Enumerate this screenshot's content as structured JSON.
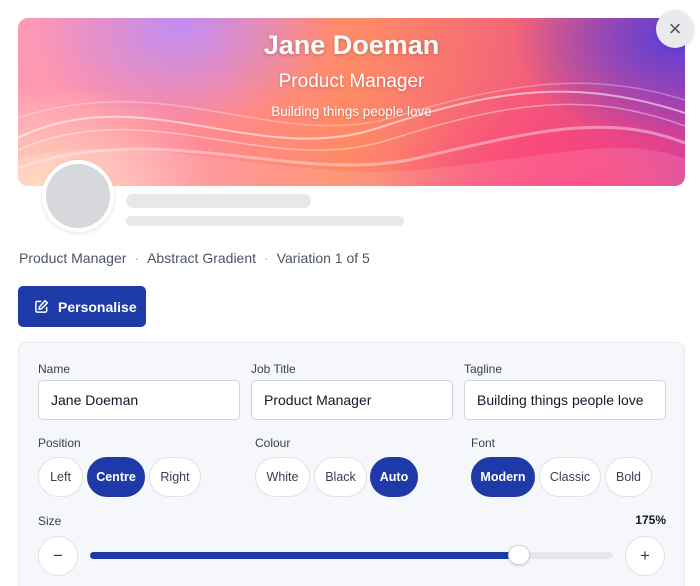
{
  "banner": {
    "name": "Jane Doeman",
    "job_title": "Product Manager",
    "tagline": "Building things people love"
  },
  "close_label": "×",
  "meta": [
    "Product Manager",
    "Abstract Gradient",
    "Variation 1 of 5"
  ],
  "meta_separator": "·",
  "personalise_label": "Personalise",
  "form": {
    "name_label": "Name",
    "name_value": "Jane Doeman",
    "job_title_label": "Job Title",
    "job_title_value": "Product Manager",
    "tagline_label": "Tagline",
    "tagline_value": "Building things people love",
    "position_label": "Position",
    "position_options": [
      "Left",
      "Centre",
      "Right"
    ],
    "position_selected": "Centre",
    "colour_label": "Colour",
    "colour_options": [
      "White",
      "Black",
      "Auto"
    ],
    "colour_selected": "Auto",
    "font_label": "Font",
    "font_options": [
      "Modern",
      "Classic",
      "Bold"
    ],
    "font_selected": "Modern",
    "size_label": "Size",
    "size_value_text": "175%",
    "size_slider_fraction": 0.82,
    "minus_label": "−",
    "plus_label": "+"
  },
  "colors": {
    "accent": "#1e3aa8",
    "panel_bg": "#f5f7fa"
  }
}
